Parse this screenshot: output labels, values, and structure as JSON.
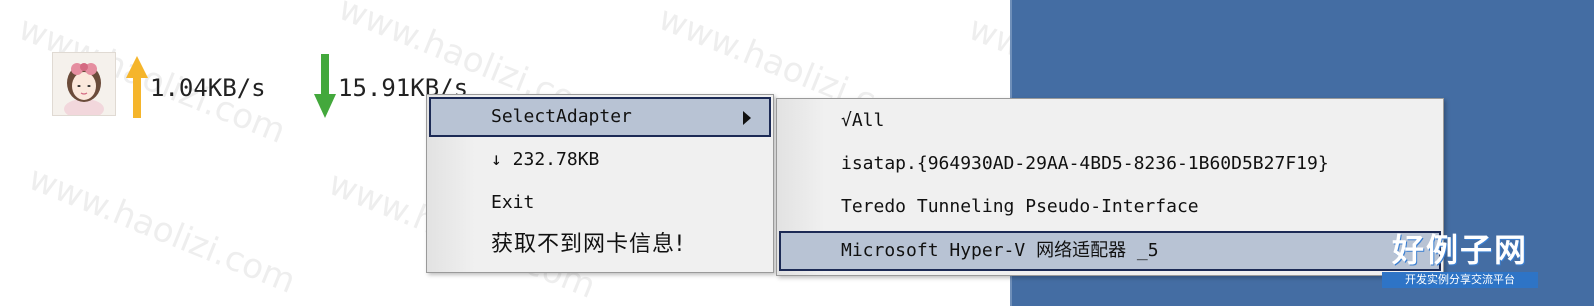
{
  "widget": {
    "upload_speed": "1.04KB/s",
    "download_speed": "15.91KB/s",
    "upload_arrow_color": "#f5b52b",
    "download_arrow_color": "#43a83c",
    "avatar_icon": "avatar-girl-icon"
  },
  "context_menu": {
    "items": [
      {
        "label": "SelectAdapter",
        "has_submenu": true,
        "highlighted": true
      },
      {
        "label": "↓ 232.78KB"
      },
      {
        "label": "Exit"
      },
      {
        "label": "获取不到网卡信息!"
      }
    ]
  },
  "adapter_submenu": {
    "items": [
      {
        "label": "√All"
      },
      {
        "label": "isatap.{964930AD-29AA-4BD5-8236-1B60D5B27F19}"
      },
      {
        "label": "Teredo Tunneling Pseudo-Interface"
      },
      {
        "label": "Microsoft Hyper-V 网络适配器 _5",
        "highlighted": true
      }
    ]
  },
  "watermark": {
    "text": "www.haolizi.com",
    "brand_name": "好例子网",
    "brand_slogan": "开发实例分享交流平台"
  },
  "colors": {
    "menu_background": "#f0f0f0",
    "menu_highlight": "#b8c3d4",
    "menu_highlight_border": "#1c2a55",
    "desktop_background": "#446da3"
  }
}
